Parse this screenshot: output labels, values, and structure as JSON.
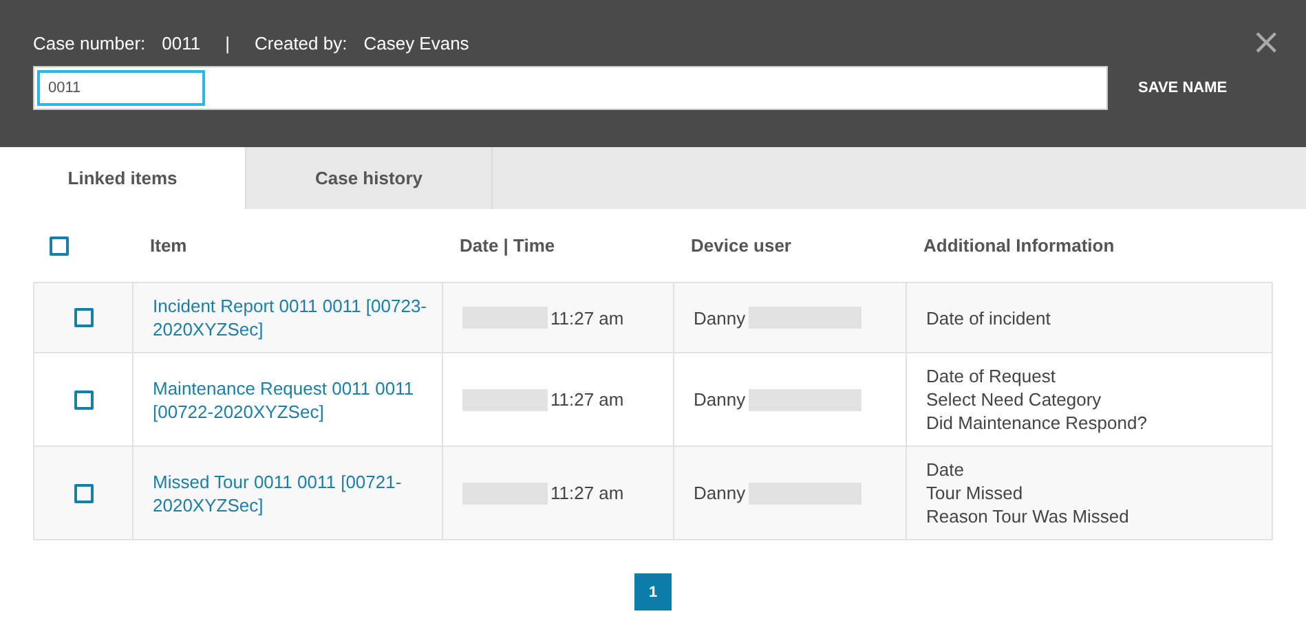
{
  "header": {
    "case_number_label": "Case number:",
    "case_number": "0011",
    "separator": "|",
    "created_by_label": "Created by:",
    "created_by": "Casey Evans",
    "name_field": {
      "value": "0011",
      "focused": true
    },
    "save_button": "SAVE NAME",
    "close": "×"
  },
  "tabs": [
    {
      "label": "Linked items",
      "selected": true
    },
    {
      "label": "Case history",
      "selected": false
    }
  ],
  "table": {
    "select_all": {
      "checked": false
    },
    "columns": [
      "Item",
      "Date | Time",
      "Device user",
      "Additional Information"
    ],
    "rows": [
      {
        "checked": false,
        "item": "Incident Report 0011 0011 [00723-2020XYZSec]",
        "time": "11:27 am",
        "user": "Danny",
        "info": [
          "Date of incident"
        ]
      },
      {
        "checked": false,
        "item": "Maintenance Request 0011 0011 [00722-2020XYZSec]",
        "time": "11:27 am",
        "user": "Danny",
        "info": [
          "Date of Request",
          "Select Need Category",
          "Did Maintenance Respond?"
        ]
      },
      {
        "checked": false,
        "item": "Missed Tour 0011 0011 [00721-2020XYZSec]",
        "time": "11:27 am",
        "user": "Danny",
        "info": [
          "Date",
          "Tour Missed",
          "Reason Tour Was Missed"
        ]
      }
    ]
  },
  "pagination": [
    {
      "label": "1",
      "selected": true
    }
  ]
}
